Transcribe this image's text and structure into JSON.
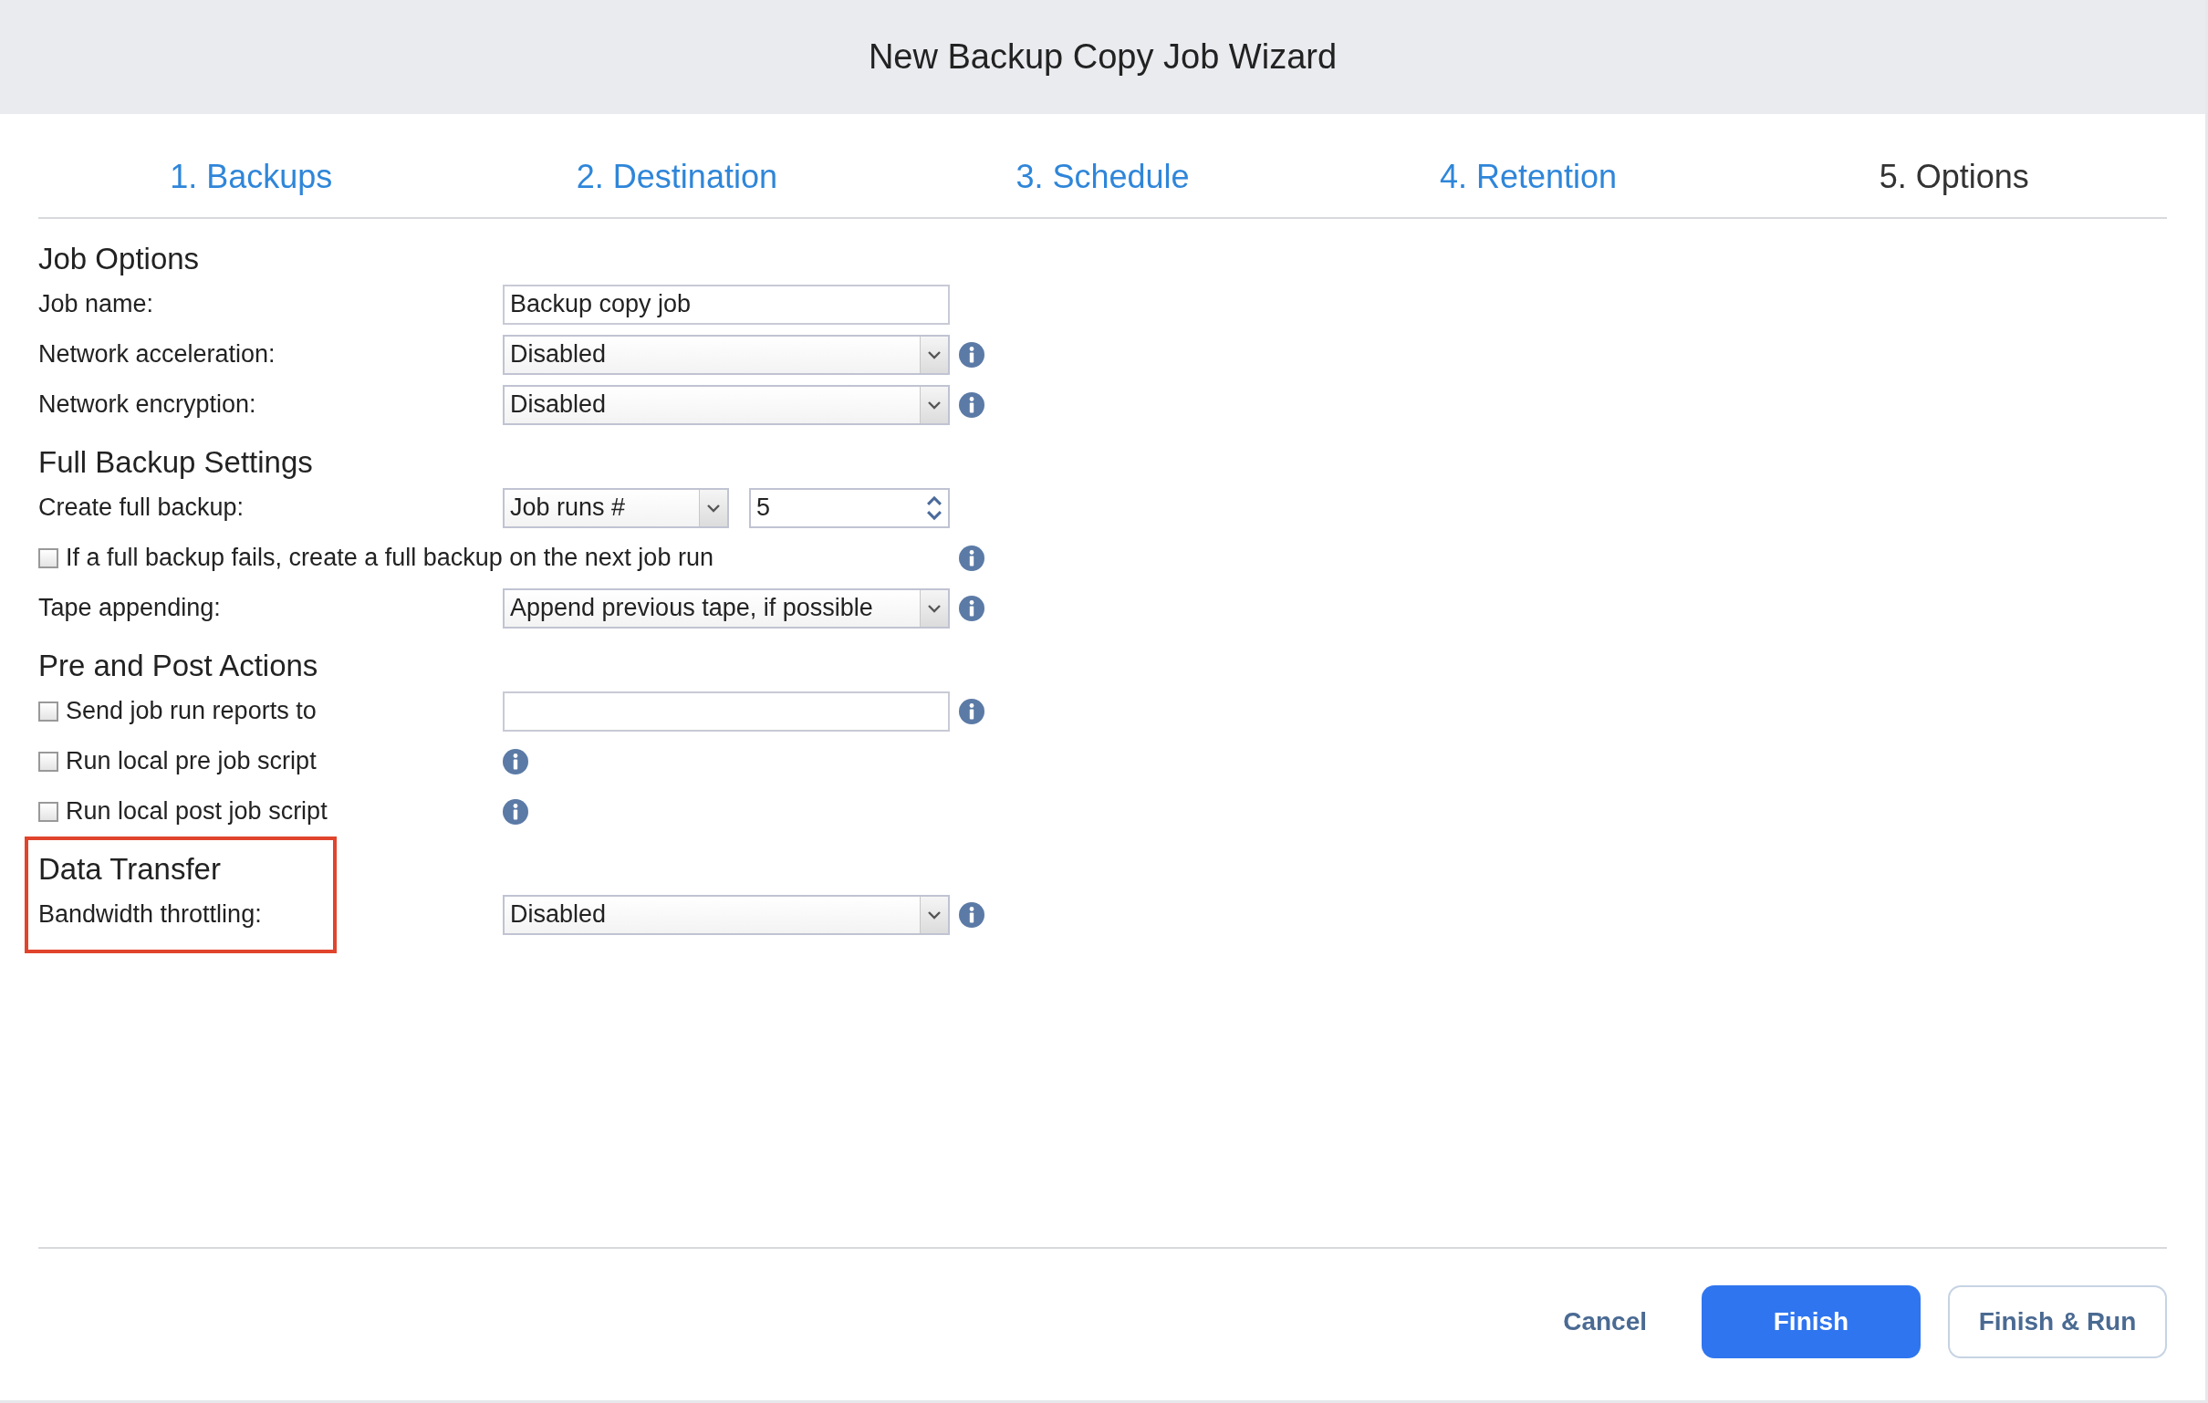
{
  "window": {
    "title": "New Backup Copy Job Wizard"
  },
  "tabs": [
    {
      "label": "1. Backups",
      "selected": false
    },
    {
      "label": "2. Destination",
      "selected": false
    },
    {
      "label": "3. Schedule",
      "selected": false
    },
    {
      "label": "4. Retention",
      "selected": false
    },
    {
      "label": "5. Options",
      "selected": true
    }
  ],
  "sections": [
    {
      "heading": "Job Options",
      "highlighted": false,
      "rows": [
        {
          "kind": "text_field",
          "label": "Job name:",
          "value": "Backup copy job",
          "info": false
        },
        {
          "kind": "select",
          "label": "Network acceleration:",
          "value": "Disabled",
          "info": true
        },
        {
          "kind": "select",
          "label": "Network encryption:",
          "value": "Disabled",
          "info": true
        }
      ]
    },
    {
      "heading": "Full Backup Settings",
      "highlighted": false,
      "rows": [
        {
          "kind": "select_spinner",
          "label": "Create full backup:",
          "value": "Job runs #",
          "number": "5",
          "info": false
        },
        {
          "kind": "checkbox_wide",
          "label": "If a full backup fails, create a full backup on the next job run",
          "checked": false,
          "info": true
        },
        {
          "kind": "select",
          "label": "Tape appending:",
          "value": "Append previous tape, if possible",
          "info": true
        }
      ]
    },
    {
      "heading": "Pre and Post Actions",
      "highlighted": false,
      "rows": [
        {
          "kind": "checkbox_field",
          "label": "Send job run reports to",
          "checked": false,
          "info": true
        },
        {
          "kind": "checkbox_info",
          "label": "Run local pre job script",
          "checked": false,
          "info": true
        },
        {
          "kind": "checkbox_info",
          "label": "Run local post job script",
          "checked": false,
          "info": true
        }
      ]
    },
    {
      "heading": "Data Transfer",
      "highlighted": true,
      "rows": [
        {
          "kind": "select",
          "label": "Bandwidth throttling:",
          "value": "Disabled",
          "info": true
        }
      ]
    }
  ],
  "buttons": [
    {
      "kind": "link",
      "label": "Cancel"
    },
    {
      "kind": "primary",
      "label": "Finish"
    },
    {
      "kind": "secondary",
      "label": "Finish & Run"
    }
  ]
}
